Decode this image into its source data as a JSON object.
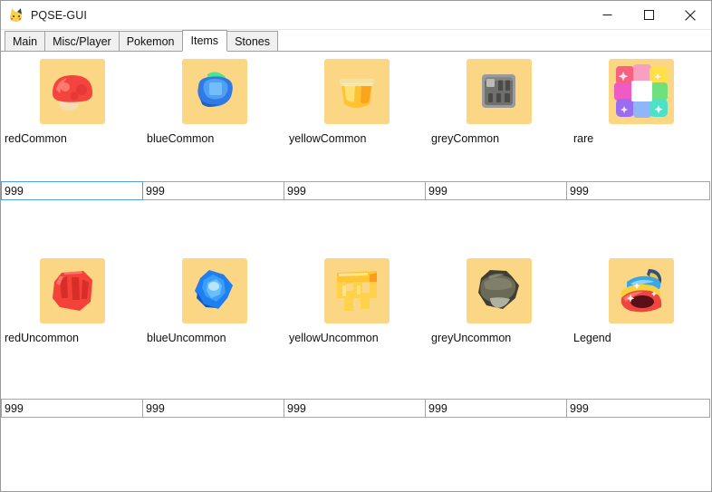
{
  "window": {
    "title": "PQSE-GUI",
    "icon": "pikachu-icon",
    "controls": {
      "minimize": "minimize-icon",
      "maximize": "maximize-icon",
      "close": "close-icon"
    }
  },
  "tabs": [
    {
      "label": "Main",
      "selected": false
    },
    {
      "label": "Misc/Player",
      "selected": false
    },
    {
      "label": "Pokemon",
      "selected": false
    },
    {
      "label": "Items",
      "selected": true
    },
    {
      "label": "Stones",
      "selected": false
    }
  ],
  "items": {
    "row1": [
      {
        "label": "redCommon",
        "value": "999",
        "icon": "red-mushroom-icon",
        "focused": true
      },
      {
        "label": "blueCommon",
        "value": "999",
        "icon": "blue-gem-icon",
        "focused": false
      },
      {
        "label": "yellowCommon",
        "value": "999",
        "icon": "yellow-bucket-icon",
        "focused": false
      },
      {
        "label": "greyCommon",
        "value": "999",
        "icon": "grey-chip-icon",
        "focused": false
      },
      {
        "label": "rare",
        "value": "999",
        "icon": "rainbow-square-icon",
        "focused": false
      }
    ],
    "row2": [
      {
        "label": "redUncommon",
        "value": "999",
        "icon": "red-crystal-icon",
        "focused": false
      },
      {
        "label": "blueUncommon",
        "value": "999",
        "icon": "blue-crystal-icon",
        "focused": false
      },
      {
        "label": "yellowUncommon",
        "value": "999",
        "icon": "yellow-crystal-icon",
        "focused": false
      },
      {
        "label": "greyUncommon",
        "value": "999",
        "icon": "grey-rock-icon",
        "focused": false
      },
      {
        "label": "Legend",
        "value": "999",
        "icon": "legend-stack-icon",
        "focused": false
      }
    ]
  },
  "colors": {
    "sprite_background": "#fbd684",
    "focus_border": "#4ea0e0",
    "tab_inactive": "#f0f0f0",
    "tab_active": "#ffffff",
    "border": "#a0a0a0"
  }
}
